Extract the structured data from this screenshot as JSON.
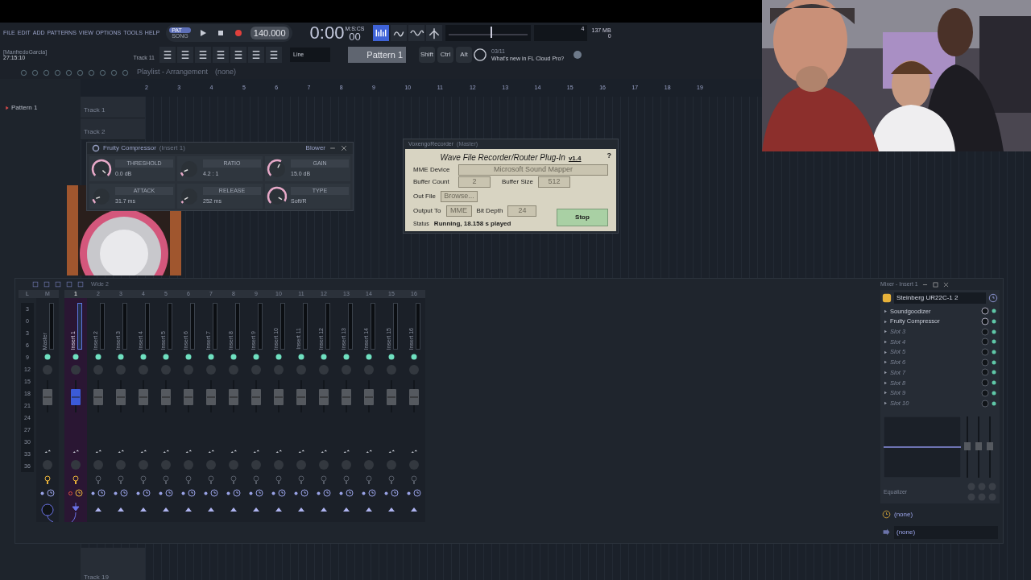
{
  "menu": [
    "FILE",
    "EDIT",
    "ADD",
    "PATTERNS",
    "VIEW",
    "OPTIONS",
    "TOOLS",
    "HELP"
  ],
  "transport": {
    "modes": [
      {
        "label": "PAT",
        "selected": true
      },
      {
        "label": "SONG",
        "selected": false
      }
    ],
    "playing": false,
    "recording": true,
    "tempo": "140.000",
    "time": "0:00",
    "time_fraction": "00",
    "time_unit": "M:S:CS",
    "cpu": "4",
    "memory": "137 MB",
    "polyphony": "0"
  },
  "hint_bar": {
    "user": "[ManfredoGarcia]",
    "time": "27:15:10",
    "track": "Track 11"
  },
  "toolbar": {
    "snap": "Line",
    "pattern": "Pattern 1",
    "keys": [
      "Shift",
      "Ctrl",
      "Alt"
    ],
    "news_count": "03/11",
    "news": "What's new in FL Cloud Pro?"
  },
  "browser": {
    "patterns": [
      "Pattern 1"
    ]
  },
  "playlist": {
    "title": "Playlist - Arrangement",
    "trail": "(none)",
    "ruler": [
      "2",
      "3",
      "4",
      "5",
      "6",
      "7",
      "8",
      "9",
      "10",
      "11",
      "12",
      "13",
      "14",
      "15",
      "16",
      "17",
      "18",
      "19"
    ],
    "tracks": [
      "Track 1",
      "Track 2"
    ],
    "last_track": "Track 19"
  },
  "compressor": {
    "title": "Fruity Compressor",
    "context": "(Insert 1)",
    "preset": "Blower",
    "params": [
      {
        "label": "THRESHOLD",
        "value": "0.0 dB"
      },
      {
        "label": "RATIO",
        "value": "4.2 : 1"
      },
      {
        "label": "GAIN",
        "value": "15.0 dB"
      },
      {
        "label": "ATTACK",
        "value": "31.7 ms"
      },
      {
        "label": "RELEASE",
        "value": "252 ms"
      },
      {
        "label": "TYPE",
        "value": "Soft/R"
      }
    ]
  },
  "recorder": {
    "title": "VoxengoRecorder",
    "context": "(Master)",
    "heading": "Wave File Recorder/Router Plug-In",
    "version": "v1.4",
    "help": "?",
    "device_label": "MME Device",
    "device": "Microsoft Sound Mapper",
    "buffer_count_label": "Buffer Count",
    "buffer_count": "2",
    "buffer_size_label": "Buffer Size",
    "buffer_size": "512",
    "out_file_label": "Out File",
    "browse": "Browse...",
    "output_label": "Output To",
    "output": "MME",
    "bit_depth_label": "Bit Depth",
    "bit_depth": "24",
    "status_label": "Status",
    "status": "Running, 18.158 s played",
    "stop": "Stop"
  },
  "mixer": {
    "preset": "Wide 2",
    "scale_header": "L",
    "scale": [
      "3",
      "0",
      "3",
      "6",
      "9",
      "12",
      "15",
      "18",
      "21",
      "24",
      "27",
      "30",
      "33",
      "36"
    ],
    "strips": [
      {
        "kind": "master",
        "number": "M",
        "name": "Master",
        "selected": false,
        "level": 0.45
      },
      {
        "kind": "insert",
        "number": "1",
        "name": "Insert 1",
        "selected": true,
        "level": 0.45
      },
      {
        "kind": "insert",
        "number": "2",
        "name": "Insert 2",
        "selected": false,
        "level": 0.45
      },
      {
        "kind": "insert",
        "number": "3",
        "name": "Insert 3",
        "selected": false,
        "level": 0.45
      },
      {
        "kind": "insert",
        "number": "4",
        "name": "Insert 4",
        "selected": false,
        "level": 0.45
      },
      {
        "kind": "insert",
        "number": "5",
        "name": "Insert 5",
        "selected": false,
        "level": 0.45
      },
      {
        "kind": "insert",
        "number": "6",
        "name": "Insert 6",
        "selected": false,
        "level": 0.45
      },
      {
        "kind": "insert",
        "number": "7",
        "name": "Insert 7",
        "selected": false,
        "level": 0.45
      },
      {
        "kind": "insert",
        "number": "8",
        "name": "Insert 8",
        "selected": false,
        "level": 0.45
      },
      {
        "kind": "insert",
        "number": "9",
        "name": "Insert 9",
        "selected": false,
        "level": 0.45
      },
      {
        "kind": "insert",
        "number": "10",
        "name": "Insert 10",
        "selected": false,
        "level": 0.45
      },
      {
        "kind": "insert",
        "number": "11",
        "name": "Insert 11",
        "selected": false,
        "level": 0.45
      },
      {
        "kind": "insert",
        "number": "12",
        "name": "Insert 12",
        "selected": false,
        "level": 0.45
      },
      {
        "kind": "insert",
        "number": "13",
        "name": "Insert 13",
        "selected": false,
        "level": 0.45
      },
      {
        "kind": "insert",
        "number": "14",
        "name": "Insert 14",
        "selected": false,
        "level": 0.45
      },
      {
        "kind": "insert",
        "number": "15",
        "name": "Insert 15",
        "selected": false,
        "level": 0.45
      },
      {
        "kind": "insert",
        "number": "16",
        "name": "Insert 16",
        "selected": false,
        "level": 0.45
      }
    ]
  },
  "insert_panel": {
    "title": "Mixer - Insert 1",
    "input": "Steinberg UR22C-1 2",
    "slots": [
      {
        "name": "Soundgoodizer",
        "empty": false
      },
      {
        "name": "Fruity Compressor",
        "empty": false
      },
      {
        "name": "Slot 3",
        "empty": true
      },
      {
        "name": "Slot 4",
        "empty": true
      },
      {
        "name": "Slot 5",
        "empty": true
      },
      {
        "name": "Slot 6",
        "empty": true
      },
      {
        "name": "Slot 7",
        "empty": true
      },
      {
        "name": "Slot 8",
        "empty": true
      },
      {
        "name": "Slot 9",
        "empty": true
      },
      {
        "name": "Slot 10",
        "empty": true
      }
    ],
    "eq_label": "Equalizer",
    "input_route": "(none)",
    "output_route": "(none)"
  }
}
